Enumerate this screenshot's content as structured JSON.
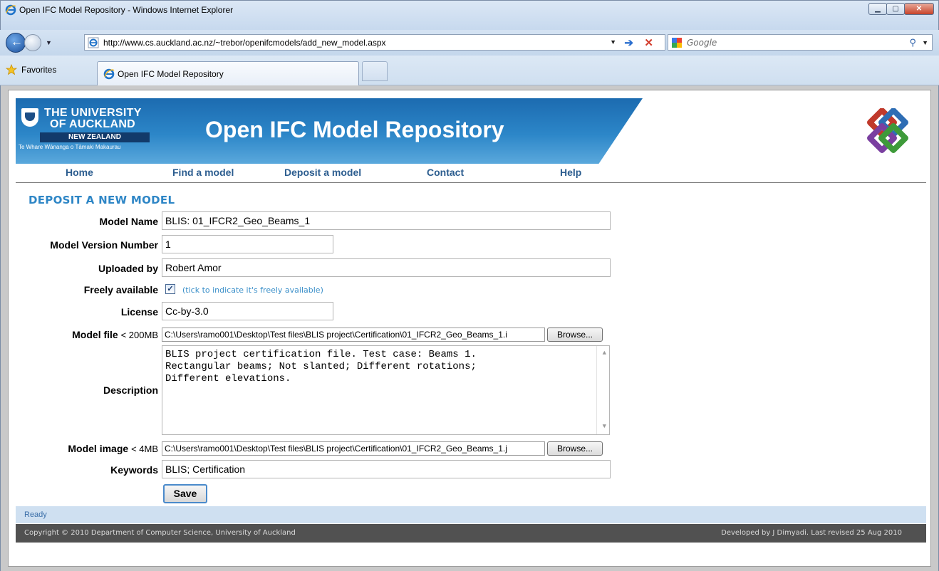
{
  "window": {
    "title": "Open IFC Model Repository - Windows Internet Explorer",
    "address_url": "http://www.cs.auckland.ac.nz/~trebor/openifcmodels/add_new_model.aspx",
    "search_placeholder": "Google",
    "favorites_label": "Favorites",
    "tab_title": "Open IFC Model Repository"
  },
  "banner": {
    "university_line1": "THE UNIVERSITY",
    "university_line2": "OF AUCKLAND",
    "university_line3": "NEW ZEALAND",
    "university_line4": "Te Whare Wānanga o Tāmaki Makaurau",
    "site_title": "Open IFC Model Repository"
  },
  "nav": [
    "Home",
    "Find a model",
    "Deposit a model",
    "Contact",
    "Help"
  ],
  "form": {
    "heading": "DEPOSIT A NEW MODEL",
    "model_name_label": "Model Name",
    "model_name_value": "BLIS: 01_IFCR2_Geo_Beams_1",
    "version_label": "Model Version Number",
    "version_value": "1",
    "uploaded_by_label": "Uploaded by",
    "uploaded_by_value": "Robert Amor",
    "freely_available_label": "Freely available",
    "freely_available_checked": true,
    "freely_available_hint": "(tick to indicate it's freely available)",
    "license_label": "License",
    "license_value": "Cc-by-3.0",
    "model_file_label": "Model file",
    "model_file_limit": "< 200MB",
    "model_file_value": "C:\\Users\\ramo001\\Desktop\\Test files\\BLIS project\\Certification\\01_IFCR2_Geo_Beams_1.i",
    "browse_label": "Browse...",
    "description_label": "Description",
    "description_value": "BLIS project certification file. Test case: Beams 1.\nRectangular beams; Not slanted; Different rotations;\nDifferent elevations.",
    "model_image_label": "Model image",
    "model_image_limit": "< 4MB",
    "model_image_value": "C:\\Users\\ramo001\\Desktop\\Test files\\BLIS project\\Certification\\01_IFCR2_Geo_Beams_1.j",
    "keywords_label": "Keywords",
    "keywords_value": "BLIS; Certification",
    "save_label": "Save"
  },
  "status": {
    "text": "Ready"
  },
  "footer": {
    "left": "Copyright © 2010  Department of Computer Science, University of Auckland",
    "right": "Developed by J Dimyadi. Last revised  25 Aug 2010"
  },
  "colors": {
    "banner_blue": "#2c86c8",
    "nav_link": "#2c5d8f",
    "heading": "#2e86c6",
    "footer_bg": "#515151"
  }
}
